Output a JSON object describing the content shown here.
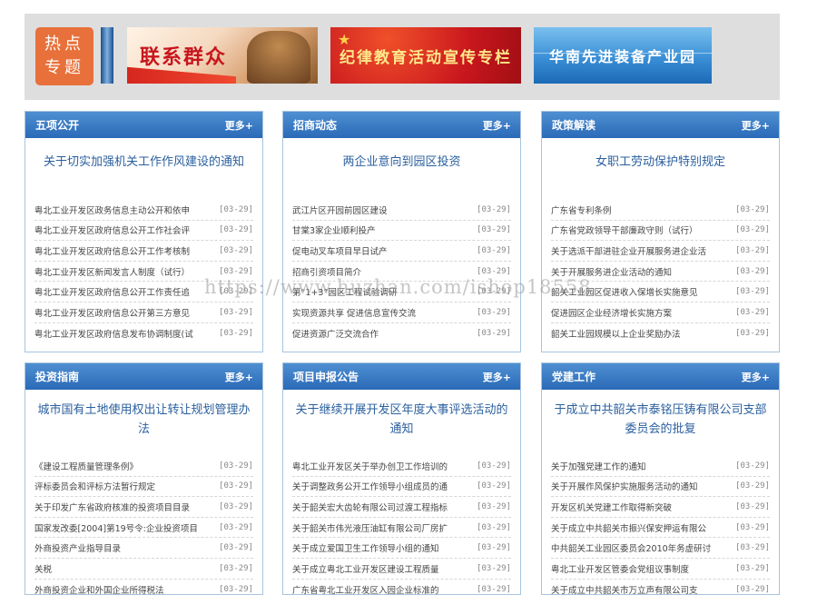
{
  "hot_topics": {
    "label_line1": "热点",
    "label_line2": "专题"
  },
  "banners": [
    {
      "text": "联系群众"
    },
    {
      "text": "纪律教育活动宣传专栏"
    },
    {
      "text": "华南先进装备产业园"
    }
  ],
  "more_label": "更多+",
  "watermark": "https://www.huzhan.com/ishop18558",
  "panels": [
    {
      "title": "五项公开",
      "headline": "关于切实加强机关工作作风建设的通知",
      "items": [
        {
          "text": "粤北工业开发区政务信息主动公开和依申",
          "date": "[03-29]"
        },
        {
          "text": "粤北工业开发区政府信息公开工作社会评",
          "date": "[03-29]"
        },
        {
          "text": "粤北工业开发区政府信息公开工作考核制",
          "date": "[03-29]"
        },
        {
          "text": "粤北工业开发区新闻发言人制度（试行）",
          "date": "[03-29]"
        },
        {
          "text": "粤北工业开发区政府信息公开工作责任追",
          "date": "[03-29]"
        },
        {
          "text": "粤北工业开发区政府信息公开第三方意见",
          "date": "[03-29]"
        },
        {
          "text": "粤北工业开发区政府信息发布协调制度(试",
          "date": "[03-29]"
        }
      ]
    },
    {
      "title": "招商动态",
      "headline": "两企业意向到园区投资",
      "items": [
        {
          "text": "武江片区开园前园区建设",
          "date": "[03-29]"
        },
        {
          "text": "甘棠3家企业顺利投产",
          "date": "[03-29]"
        },
        {
          "text": "促电动叉车项目早日试产",
          "date": "[03-29]"
        },
        {
          "text": "招商引资项目简介",
          "date": "[03-29]"
        },
        {
          "text": "第“1+3”园区工程试验调研",
          "date": "[03-29]"
        },
        {
          "text": "实现资源共享 促进信息宣传交流",
          "date": "[03-29]"
        },
        {
          "text": "促进资源广泛交流合作",
          "date": "[03-29]"
        }
      ]
    },
    {
      "title": "政策解读",
      "headline": "女职工劳动保护特别规定",
      "items": [
        {
          "text": "广东省专利条例",
          "date": "[03-29]"
        },
        {
          "text": "广东省党政领导干部廉政守则（试行）",
          "date": "[03-29]"
        },
        {
          "text": "关于选派干部进驻企业开展服务进企业活",
          "date": "[03-29]"
        },
        {
          "text": "关于开展服务进企业活动的通知",
          "date": "[03-29]"
        },
        {
          "text": "韶关工业园区促进收入保增长实施意见",
          "date": "[03-29]"
        },
        {
          "text": "促进园区企业经济增长实施方案",
          "date": "[03-29]"
        },
        {
          "text": "韶关工业园规模以上企业奖励办法",
          "date": "[03-29]"
        }
      ]
    },
    {
      "title": "投资指南",
      "headline": "城市国有土地使用权出让转让规划管理办法",
      "items": [
        {
          "text": "《建设工程质量管理条例》",
          "date": "[03-29]"
        },
        {
          "text": "评标委员会和评标方法暂行规定",
          "date": "[03-29]"
        },
        {
          "text": "关于印发广东省政府核准的投资项目目录",
          "date": "[03-29]"
        },
        {
          "text": "国家发改委[2004]第19号令:企业投资项目",
          "date": "[03-29]"
        },
        {
          "text": "外商投资产业指导目录",
          "date": "[03-29]"
        },
        {
          "text": "关税",
          "date": "[03-29]"
        },
        {
          "text": "外商投资企业和外国企业所得税法",
          "date": "[03-29]"
        }
      ]
    },
    {
      "title": "项目申报公告",
      "headline": "关于继续开展开发区年度大事评选活动的通知",
      "items": [
        {
          "text": "粤北工业开发区关于举办创卫工作培训的",
          "date": "[03-29]"
        },
        {
          "text": "关于调整政务公开工作领导小组成员的通",
          "date": "[03-29]"
        },
        {
          "text": "关于韶关宏大齿轮有限公司过渡工程指标",
          "date": "[03-29]"
        },
        {
          "text": "关于韶关市伟光液压油缸有限公司厂房扩",
          "date": "[03-29]"
        },
        {
          "text": "关于成立爱国卫生工作领导小组的通知",
          "date": "[03-29]"
        },
        {
          "text": "关于成立粤北工业开发区建设工程质量",
          "date": "[03-29]"
        },
        {
          "text": "广东省粤北工业开发区入园企业标准的",
          "date": "[03-29]"
        }
      ]
    },
    {
      "title": "党建工作",
      "headline": "于成立中共韶关市泰铭压铸有限公司支部委员会的批复",
      "items": [
        {
          "text": "关于加强党建工作的通知",
          "date": "[03-29]"
        },
        {
          "text": "关于开展作风保护实施服务活动的通知",
          "date": "[03-29]"
        },
        {
          "text": "开发区机关党建工作取得新突破",
          "date": "[03-29]"
        },
        {
          "text": "关于成立中共韶关市振兴保安押运有限公",
          "date": "[03-29]"
        },
        {
          "text": "中共韶关工业园区委员会2010年务虚研讨",
          "date": "[03-29]"
        },
        {
          "text": "粤北工业开发区管委会党组议事制度",
          "date": "[03-29]"
        },
        {
          "text": "关于成立中共韶关市万立声有限公司支",
          "date": "[03-29]"
        }
      ]
    }
  ]
}
